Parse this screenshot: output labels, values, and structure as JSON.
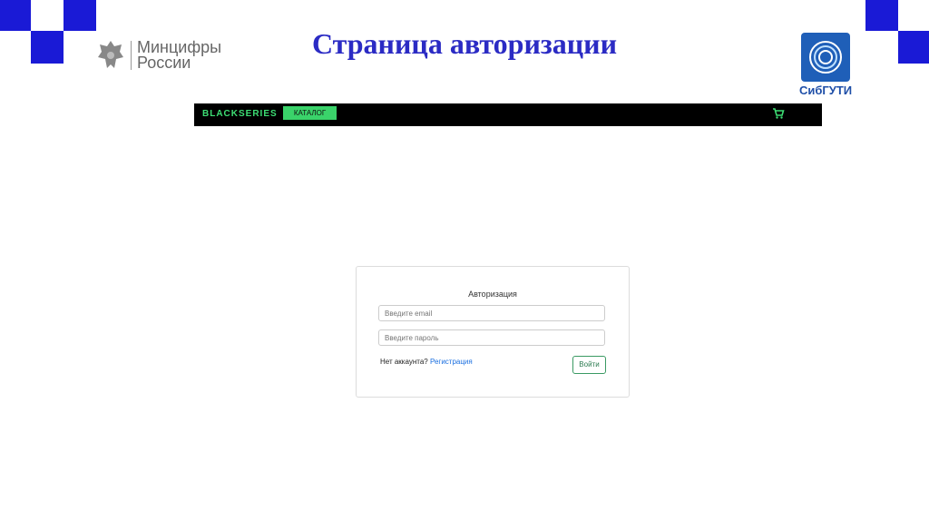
{
  "slide": {
    "title": "Страница авторизации",
    "ministry_logo_text_line1": "Минцифры",
    "ministry_logo_text_line2": "России",
    "university_logo_text": "СибГУТИ",
    "accent_color": "#1a1ad6"
  },
  "navbar": {
    "brand": "BLACKSERIES",
    "catalog_label": "КАТАЛОГ",
    "cart_icon": "cart-icon"
  },
  "login_form": {
    "title": "Авторизация",
    "email_placeholder": "Введите email",
    "password_placeholder": "Введите пароль",
    "no_account_text": "Нет аккаунта?",
    "register_link": "Регистрация",
    "submit_label": "Войти"
  }
}
